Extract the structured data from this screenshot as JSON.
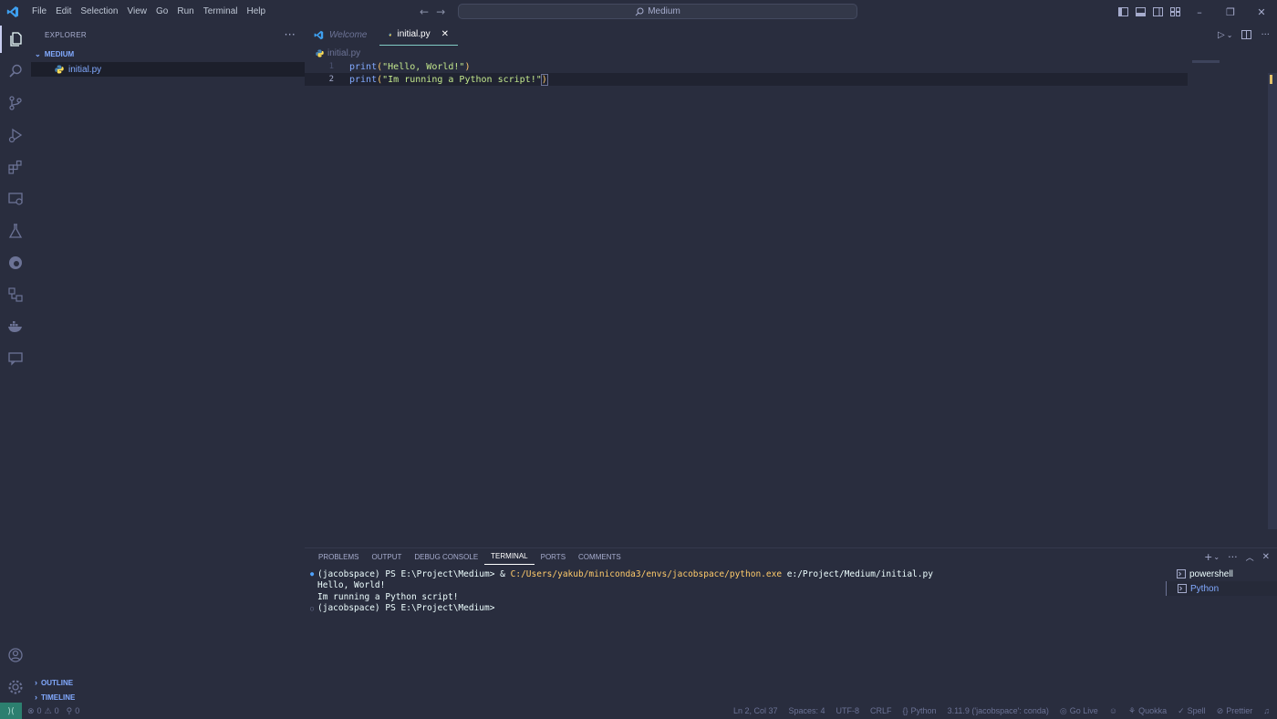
{
  "titlebar": {
    "menu": [
      "File",
      "Edit",
      "Selection",
      "View",
      "Go",
      "Run",
      "Terminal",
      "Help"
    ],
    "search": "Medium"
  },
  "sidebar": {
    "title": "EXPLORER",
    "folder": "MEDIUM",
    "files": [
      "initial.py"
    ],
    "sections": [
      "OUTLINE",
      "TIMELINE"
    ]
  },
  "editor": {
    "tabs": [
      {
        "label": "Welcome",
        "active": false
      },
      {
        "label": "initial.py",
        "active": true
      }
    ],
    "breadcrumb": "initial.py",
    "lines": [
      {
        "num": "1",
        "fn": "print",
        "open": "(",
        "str": "\"Hello, World!\"",
        "close": ")"
      },
      {
        "num": "2",
        "fn": "print",
        "open": "(",
        "str": "\"Im running a Python script!\"",
        "close": ")"
      }
    ]
  },
  "panel": {
    "tabs": [
      "PROBLEMS",
      "OUTPUT",
      "DEBUG CONSOLE",
      "TERMINAL",
      "PORTS",
      "COMMENTS"
    ],
    "active_tab": "TERMINAL",
    "terminal": {
      "line1_prompt": "(jacobspace) PS E:\\Project\\Medium> & ",
      "line1_exe": "C:/Users/yakub/miniconda3/envs/jacobspace/python.exe",
      "line1_arg": " e:/Project/Medium/initial.py",
      "line2": "Hello, World!",
      "line3": "Im running a Python script!",
      "line4": "(jacobspace) PS E:\\Project\\Medium> "
    },
    "terminal_list": [
      "powershell",
      "Python"
    ]
  },
  "statusbar": {
    "errors": "0",
    "warnings": "0",
    "ports": "0",
    "position": "Ln 2, Col 37",
    "spaces": "Spaces: 4",
    "encoding": "UTF-8",
    "eol": "CRLF",
    "language": "Python",
    "interpreter": "3.11.9 ('jacobspace': conda)",
    "golive": "Go Live",
    "quokka": "Quokka",
    "spell": "Spell",
    "prettier": "Prettier"
  },
  "colors": {
    "background": "#292d3e",
    "accent": "#82aaff",
    "string": "#c3e88d",
    "bracket": "#ffcb6b",
    "remote": "#2c7f6f"
  }
}
